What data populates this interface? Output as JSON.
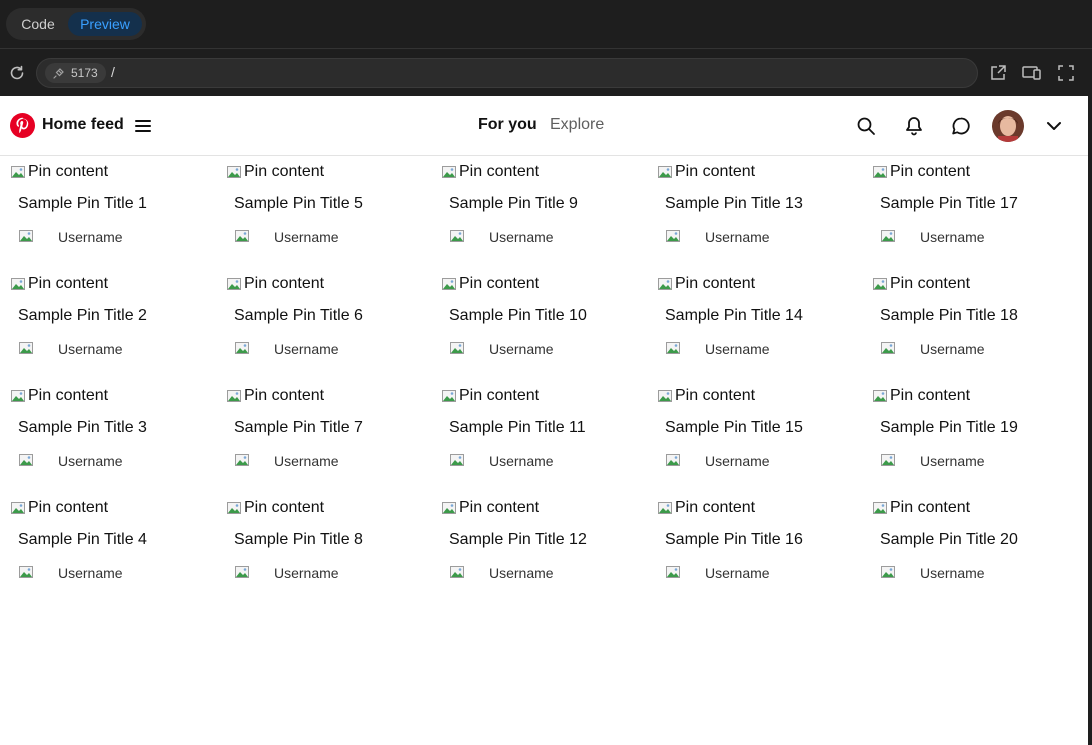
{
  "browser": {
    "mode_toggle": {
      "code_label": "Code",
      "preview_label": "Preview",
      "active": "Preview"
    },
    "port": "5173",
    "path": "/"
  },
  "header": {
    "title": "Home feed",
    "tabs": [
      {
        "label": "For you",
        "active": true
      },
      {
        "label": "Explore",
        "active": false
      }
    ],
    "icons": [
      "search-icon",
      "bell-icon",
      "chat-icon",
      "avatar",
      "chevron-down-icon"
    ]
  },
  "pins": [
    {
      "image_alt": "Pin content",
      "title": "Sample Pin Title 1",
      "username": "Username"
    },
    {
      "image_alt": "Pin content",
      "title": "Sample Pin Title 2",
      "username": "Username"
    },
    {
      "image_alt": "Pin content",
      "title": "Sample Pin Title 3",
      "username": "Username"
    },
    {
      "image_alt": "Pin content",
      "title": "Sample Pin Title 4",
      "username": "Username"
    },
    {
      "image_alt": "Pin content",
      "title": "Sample Pin Title 5",
      "username": "Username"
    },
    {
      "image_alt": "Pin content",
      "title": "Sample Pin Title 6",
      "username": "Username"
    },
    {
      "image_alt": "Pin content",
      "title": "Sample Pin Title 7",
      "username": "Username"
    },
    {
      "image_alt": "Pin content",
      "title": "Sample Pin Title 8",
      "username": "Username"
    },
    {
      "image_alt": "Pin content",
      "title": "Sample Pin Title 9",
      "username": "Username"
    },
    {
      "image_alt": "Pin content",
      "title": "Sample Pin Title 10",
      "username": "Username"
    },
    {
      "image_alt": "Pin content",
      "title": "Sample Pin Title 11",
      "username": "Username"
    },
    {
      "image_alt": "Pin content",
      "title": "Sample Pin Title 12",
      "username": "Username"
    },
    {
      "image_alt": "Pin content",
      "title": "Sample Pin Title 13",
      "username": "Username"
    },
    {
      "image_alt": "Pin content",
      "title": "Sample Pin Title 14",
      "username": "Username"
    },
    {
      "image_alt": "Pin content",
      "title": "Sample Pin Title 15",
      "username": "Username"
    },
    {
      "image_alt": "Pin content",
      "title": "Sample Pin Title 16",
      "username": "Username"
    },
    {
      "image_alt": "Pin content",
      "title": "Sample Pin Title 17",
      "username": "Username"
    },
    {
      "image_alt": "Pin content",
      "title": "Sample Pin Title 18",
      "username": "Username"
    },
    {
      "image_alt": "Pin content",
      "title": "Sample Pin Title 19",
      "username": "Username"
    },
    {
      "image_alt": "Pin content",
      "title": "Sample Pin Title 20",
      "username": "Username"
    }
  ],
  "colors": {
    "brand": "#e60023",
    "accent": "#3aa0ff",
    "chrome": "#1e1e1e"
  }
}
